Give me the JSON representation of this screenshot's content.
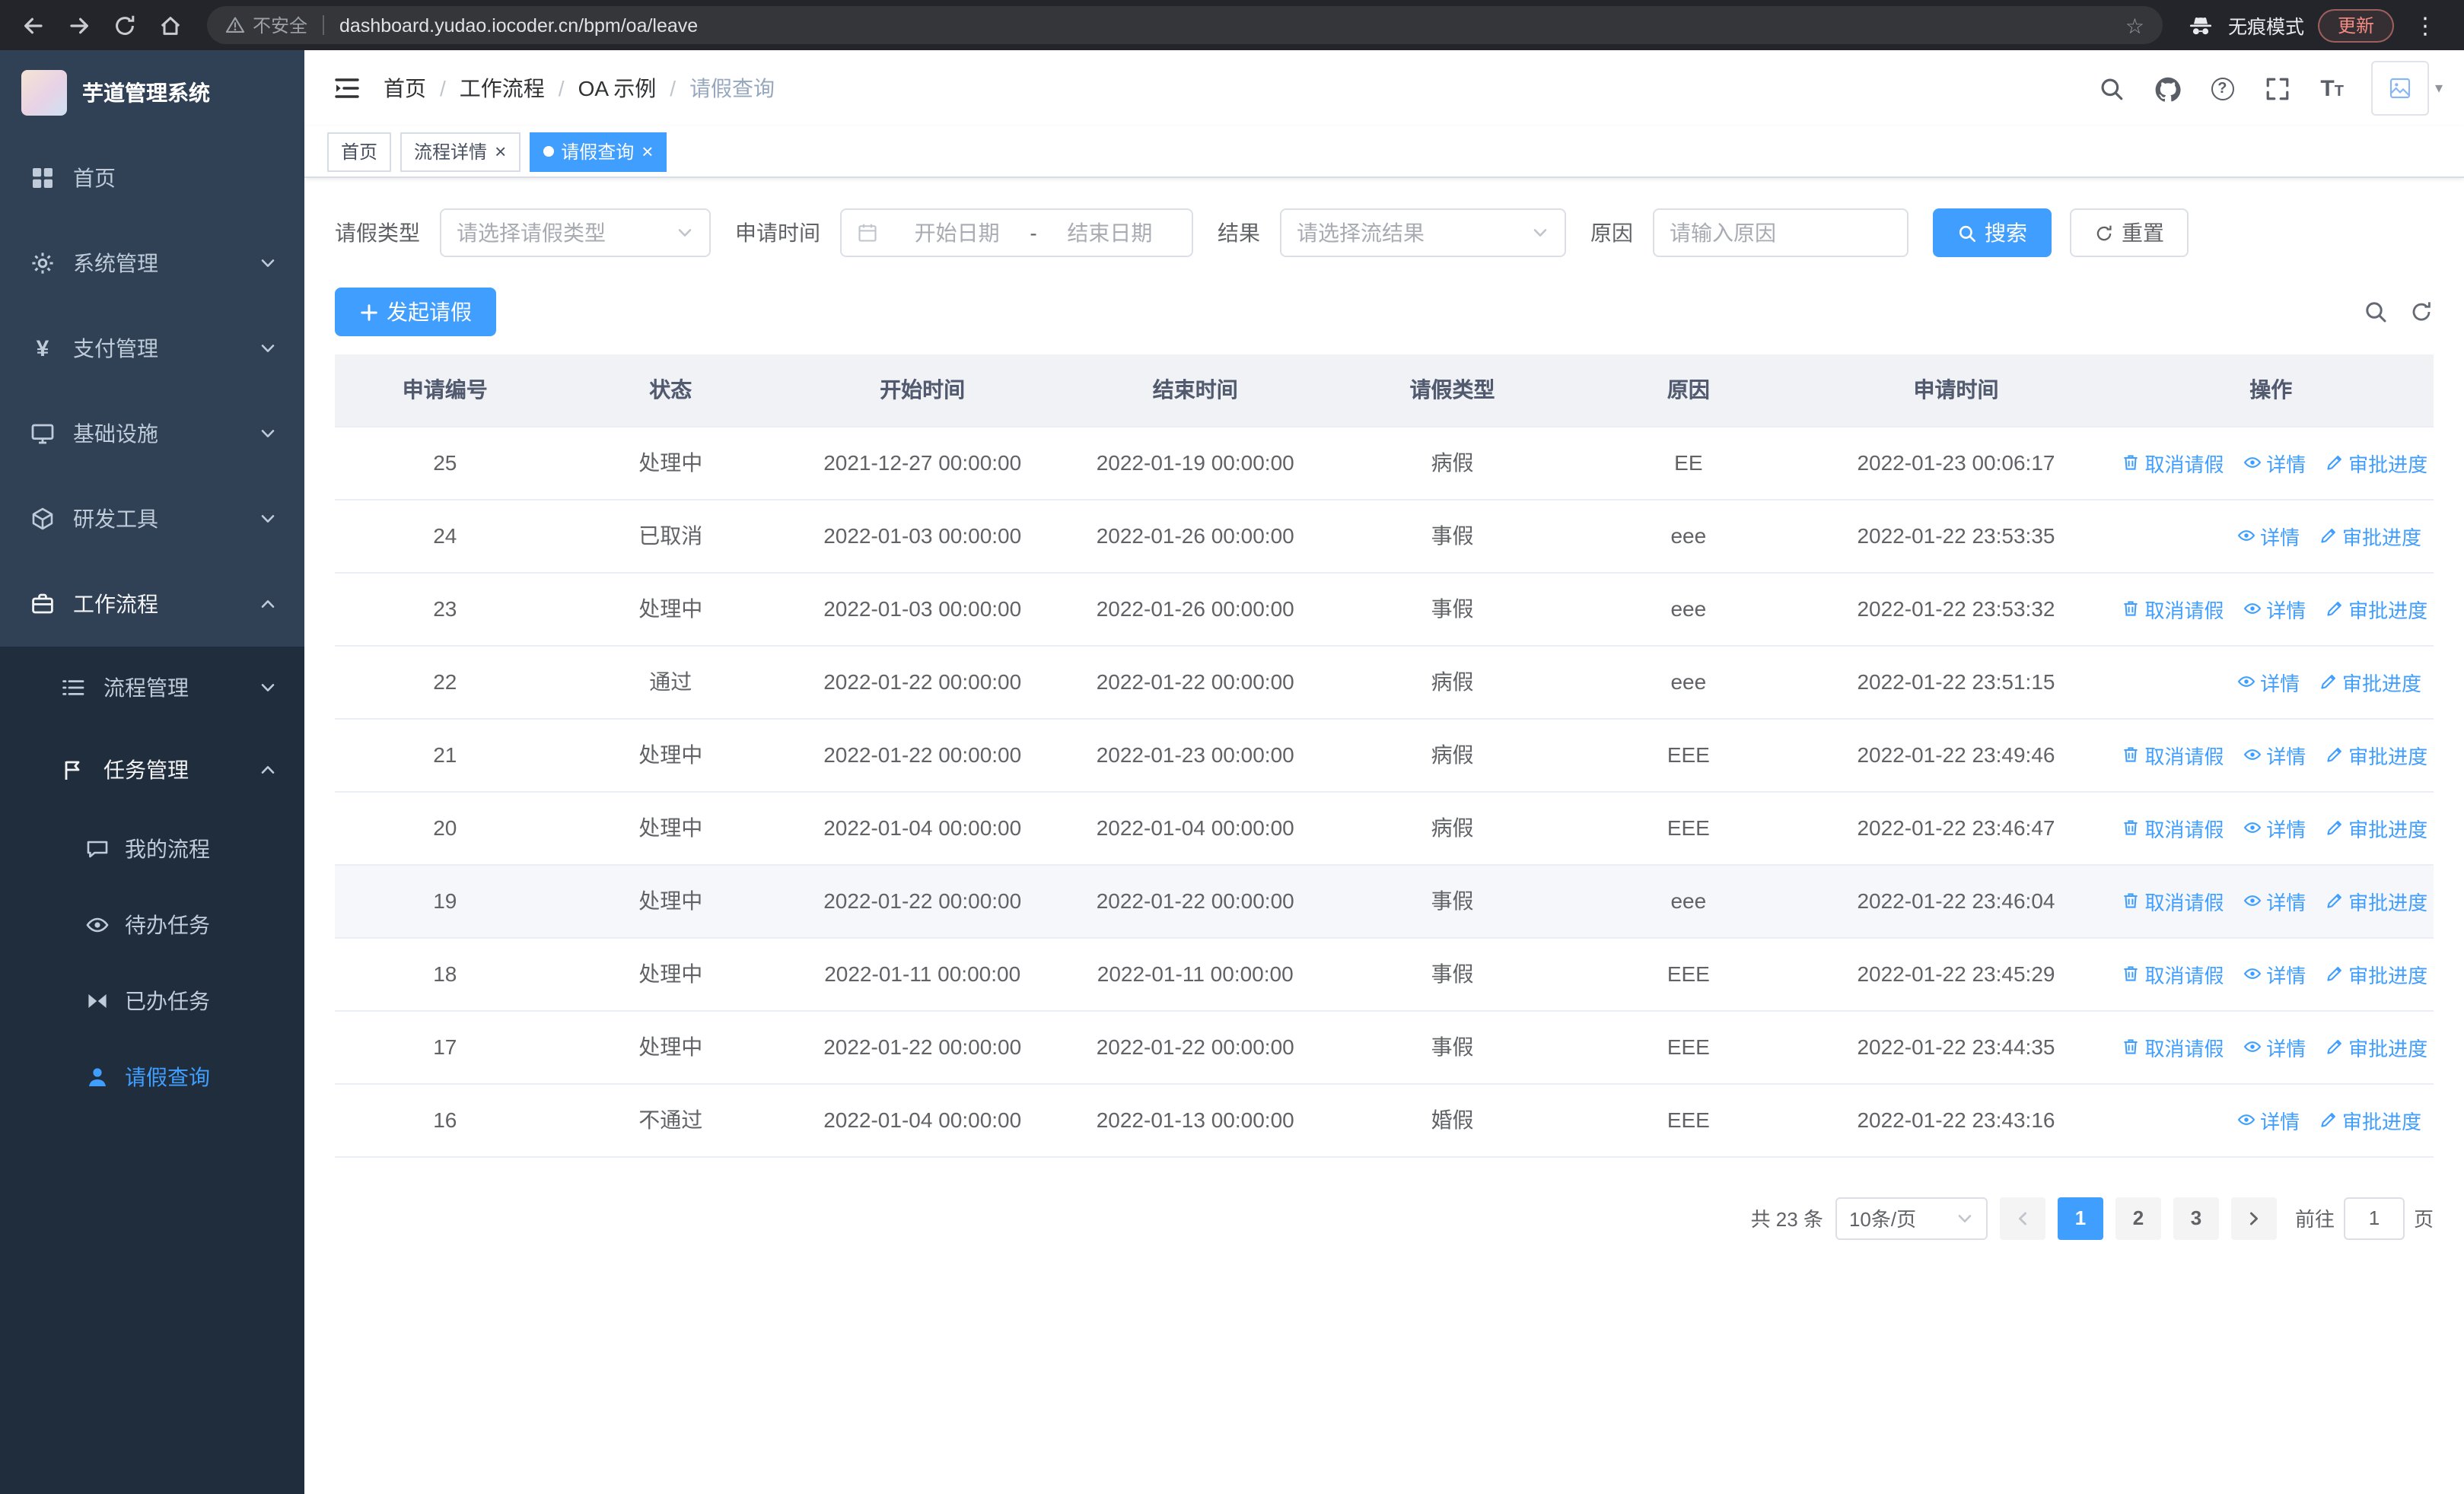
{
  "browser": {
    "security_label": "不安全",
    "url": "dashboard.yudao.iocoder.cn/bpm/oa/leave",
    "incognito_label": "无痕模式",
    "update_label": "更新"
  },
  "sidebar": {
    "logo_title": "芋道管理系统",
    "items": [
      {
        "label": "首页"
      },
      {
        "label": "系统管理"
      },
      {
        "label": "支付管理"
      },
      {
        "label": "基础设施"
      },
      {
        "label": "研发工具"
      },
      {
        "label": "工作流程"
      }
    ],
    "sub_items": [
      {
        "label": "流程管理"
      },
      {
        "label": "任务管理"
      }
    ],
    "leaf_items": [
      {
        "label": "我的流程"
      },
      {
        "label": "待办任务"
      },
      {
        "label": "已办任务"
      },
      {
        "label": "请假查询"
      }
    ]
  },
  "header": {
    "breadcrumb": [
      "首页",
      "工作流程",
      "OA 示例",
      "请假查询"
    ]
  },
  "tabs": [
    {
      "label": "首页",
      "closable": false,
      "active": false
    },
    {
      "label": "流程详情",
      "closable": true,
      "active": false
    },
    {
      "label": "请假查询",
      "closable": true,
      "active": true
    }
  ],
  "filters": {
    "leave_type": {
      "label": "请假类型",
      "placeholder": "请选择请假类型"
    },
    "apply_time": {
      "label": "申请时间",
      "start_placeholder": "开始日期",
      "separator": "-",
      "end_placeholder": "结束日期"
    },
    "result": {
      "label": "结果",
      "placeholder": "请选择流结果"
    },
    "reason": {
      "label": "原因",
      "placeholder": "请输入原因"
    },
    "search_label": "搜索",
    "reset_label": "重置"
  },
  "toolbar": {
    "create_label": "发起请假"
  },
  "table": {
    "columns": [
      "申请编号",
      "状态",
      "开始时间",
      "结束时间",
      "请假类型",
      "原因",
      "申请时间",
      "操作"
    ],
    "action_labels": {
      "cancel": "取消请假",
      "detail": "详情",
      "progress": "审批进度"
    },
    "rows": [
      {
        "id": "25",
        "status": "处理中",
        "start": "2021-12-27 00:00:00",
        "end": "2022-01-19 00:00:00",
        "type": "病假",
        "reason": "EE",
        "apply_time": "2022-01-23 00:06:17",
        "cancelable": true,
        "hover": false
      },
      {
        "id": "24",
        "status": "已取消",
        "start": "2022-01-03 00:00:00",
        "end": "2022-01-26 00:00:00",
        "type": "事假",
        "reason": "eee",
        "apply_time": "2022-01-22 23:53:35",
        "cancelable": false,
        "hover": false
      },
      {
        "id": "23",
        "status": "处理中",
        "start": "2022-01-03 00:00:00",
        "end": "2022-01-26 00:00:00",
        "type": "事假",
        "reason": "eee",
        "apply_time": "2022-01-22 23:53:32",
        "cancelable": true,
        "hover": false
      },
      {
        "id": "22",
        "status": "通过",
        "start": "2022-01-22 00:00:00",
        "end": "2022-01-22 00:00:00",
        "type": "病假",
        "reason": "eee",
        "apply_time": "2022-01-22 23:51:15",
        "cancelable": false,
        "hover": false
      },
      {
        "id": "21",
        "status": "处理中",
        "start": "2022-01-22 00:00:00",
        "end": "2022-01-23 00:00:00",
        "type": "病假",
        "reason": "EEE",
        "apply_time": "2022-01-22 23:49:46",
        "cancelable": true,
        "hover": false
      },
      {
        "id": "20",
        "status": "处理中",
        "start": "2022-01-04 00:00:00",
        "end": "2022-01-04 00:00:00",
        "type": "病假",
        "reason": "EEE",
        "apply_time": "2022-01-22 23:46:47",
        "cancelable": true,
        "hover": false
      },
      {
        "id": "19",
        "status": "处理中",
        "start": "2022-01-22 00:00:00",
        "end": "2022-01-22 00:00:00",
        "type": "事假",
        "reason": "eee",
        "apply_time": "2022-01-22 23:46:04",
        "cancelable": true,
        "hover": true
      },
      {
        "id": "18",
        "status": "处理中",
        "start": "2022-01-11 00:00:00",
        "end": "2022-01-11 00:00:00",
        "type": "事假",
        "reason": "EEE",
        "apply_time": "2022-01-22 23:45:29",
        "cancelable": true,
        "hover": false
      },
      {
        "id": "17",
        "status": "处理中",
        "start": "2022-01-22 00:00:00",
        "end": "2022-01-22 00:00:00",
        "type": "事假",
        "reason": "EEE",
        "apply_time": "2022-01-22 23:44:35",
        "cancelable": true,
        "hover": false
      },
      {
        "id": "16",
        "status": "不通过",
        "start": "2022-01-04 00:00:00",
        "end": "2022-01-13 00:00:00",
        "type": "婚假",
        "reason": "EEE",
        "apply_time": "2022-01-22 23:43:16",
        "cancelable": false,
        "hover": false
      }
    ]
  },
  "pagination": {
    "total_label": "共 23 条",
    "page_size": "10条/页",
    "pages": [
      "1",
      "2",
      "3"
    ],
    "active_page": "1",
    "goto_label": "前往",
    "goto_value": "1",
    "goto_suffix": "页"
  },
  "colors": {
    "primary": "#409eff",
    "sidebar_bg": "#304156",
    "sidebar_submenu_bg": "#1f2d3d",
    "chrome_bg": "#23252a",
    "update_text": "#f28b82"
  }
}
